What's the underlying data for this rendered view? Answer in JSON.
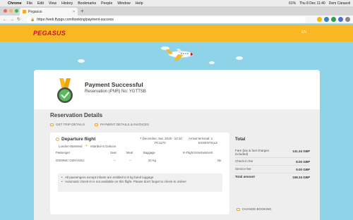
{
  "menubar": {
    "app": "Chrome",
    "items": [
      "File",
      "Edit",
      "View",
      "History",
      "Bookmarks",
      "People",
      "Window",
      "Help"
    ],
    "clock": "Thu 8 Dec 11:40",
    "user": "Dem Cárasoli",
    "battery": "61%"
  },
  "browser": {
    "tab_title": "Pegasus",
    "url": "https://web.flypgs.com/booking/payment-success"
  },
  "header": {
    "logo": "PEGASUS",
    "lang": "EN"
  },
  "success": {
    "title": "Payment Successful",
    "pnr_label": "Reservation (PNR) No: YGTTSB"
  },
  "reservation": {
    "title": "Reservation Details",
    "links": [
      "GET TRIP DETAILS",
      "PAYMENT DETAILS & INVOICES"
    ]
  },
  "flight": {
    "label": "Departure flight",
    "from": "London-Stansted",
    "to": "Istanbul-S.Gokcen",
    "datetime": "7 December, Sat, 2019 - 10:10",
    "terminal": "Arrival terminal: 1",
    "flight_no": "PC1170",
    "package": "ESSENTIALS",
    "headers": {
      "passenger": "Passenger",
      "seat": "Seat",
      "meal": "Meal",
      "baggage": "Baggage",
      "ife": "In-Flight Entertainment"
    },
    "passenger": {
      "name": "DOMINIC CERASOLI",
      "seat": "--",
      "meal": "--",
      "baggage": "20 Kg",
      "ife": "No"
    },
    "notes": [
      "All passengers except infants are entitled to 8 kg hand luggage",
      "Automatic check-in is not available on this flight. Please don't forget to check-in online!"
    ]
  },
  "total": {
    "title": "Total",
    "rows": [
      {
        "label": "Fare (tax & fuel charges included)",
        "value": "141.34 GBP"
      },
      {
        "label": "Check-in fee",
        "value": "8.00 GBP"
      },
      {
        "label": "Service fee",
        "value": "9.00 GBP"
      },
      {
        "label": "Total amount",
        "value": "158.34 GBP"
      }
    ],
    "change_booking": "CHANGE BOOKING"
  },
  "colors": {
    "brand_yellow": "#f9b823",
    "brand_red": "#c8102e",
    "sky": "#8fd3e8",
    "success_green": "#5cb85c"
  },
  "icons": [
    "apple-icon",
    "lock-icon",
    "back-icon",
    "forward-icon",
    "reload-icon",
    "plane-icon",
    "medal-check-icon",
    "document-icon",
    "invoice-icon",
    "flight-dot-icon",
    "edit-icon"
  ]
}
